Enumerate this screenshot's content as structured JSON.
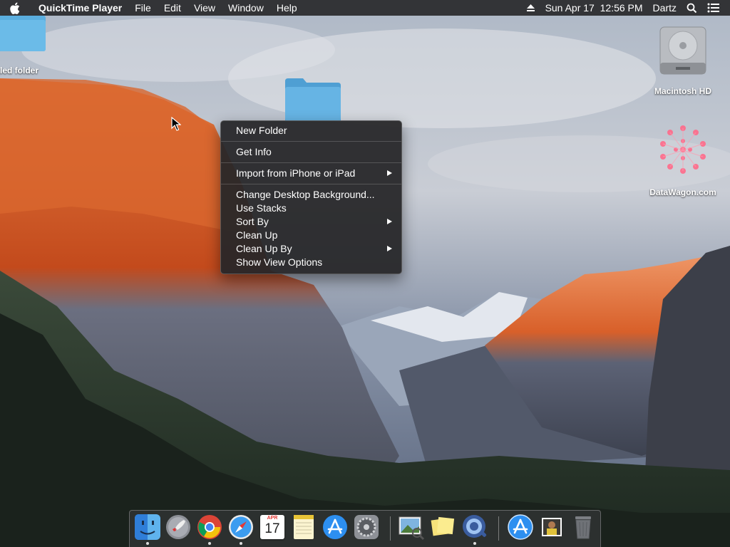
{
  "menubar": {
    "apple_icon": "apple-icon",
    "app_name": "QuickTime Player",
    "menus": [
      "File",
      "Edit",
      "View",
      "Window",
      "Help"
    ],
    "datetime": "Sun Apr 17  12:56 PM",
    "user": "Dartz",
    "status_icons": [
      "eject-icon",
      "spotlight-search-icon",
      "notification-center-icon"
    ]
  },
  "desktop": {
    "items": [
      {
        "label": "tled folder",
        "icon": "folder-icon"
      },
      {
        "label": "",
        "icon": "folder-icon"
      },
      {
        "label": "Macintosh HD",
        "icon": "hard-drive-icon"
      },
      {
        "label": "DataWagon.com",
        "icon": "datawagon-logo-icon"
      }
    ]
  },
  "context_menu": {
    "items": [
      {
        "label": "New Folder",
        "submenu": false
      },
      {
        "label": "Get Info",
        "submenu": false
      },
      {
        "label": "Import from iPhone or iPad",
        "submenu": true
      },
      {
        "label": "Change Desktop Background...",
        "submenu": false
      },
      {
        "label": "Use Stacks",
        "submenu": false
      },
      {
        "label": "Sort By",
        "submenu": true
      },
      {
        "label": "Clean Up",
        "submenu": false
      },
      {
        "label": "Clean Up By",
        "submenu": true
      },
      {
        "label": "Show View Options",
        "submenu": false
      }
    ]
  },
  "dock": {
    "calendar": {
      "month": "APR",
      "day": "17"
    },
    "apps": [
      {
        "name": "finder-icon",
        "running": true
      },
      {
        "name": "launchpad-icon",
        "running": false
      },
      {
        "name": "chrome-icon",
        "running": true
      },
      {
        "name": "safari-icon",
        "running": true
      },
      {
        "name": "calendar-icon",
        "running": false
      },
      {
        "name": "notes-icon",
        "running": false
      },
      {
        "name": "app-store-icon",
        "running": false
      },
      {
        "name": "system-preferences-icon",
        "running": false
      },
      {
        "name": "preview-icon",
        "running": false
      },
      {
        "name": "stickies-icon",
        "running": false
      },
      {
        "name": "quicktime-icon",
        "running": true
      },
      {
        "name": "app-store-downloads-icon",
        "running": false
      },
      {
        "name": "photo-stack-icon",
        "running": false
      },
      {
        "name": "trash-icon",
        "running": false
      }
    ]
  },
  "colors": {
    "menubar_bg": "#28282a",
    "menu_bg": "#262628",
    "folder_blue": "#5aaedf",
    "cliff_orange": "#d8602a"
  }
}
